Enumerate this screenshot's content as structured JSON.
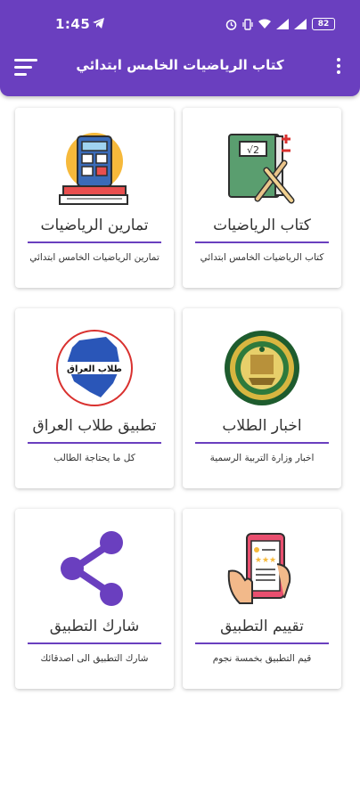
{
  "status_bar": {
    "time": "1:45",
    "battery": "82"
  },
  "app_bar": {
    "title": "كتاب الرياضيات الخامس ابتدائي"
  },
  "cards": [
    {
      "title": "كتاب الرياضيات",
      "description": "كتاب الرياضيات الخامس ابتدائي",
      "icon": "math-book-icon"
    },
    {
      "title": "تمارين الرياضيات",
      "description": "تمارين الرياضيات الخامس ابتدائي",
      "icon": "calculator-books-icon"
    },
    {
      "title": "اخبار الطلاب",
      "description": "اخبار وزارة التربية الرسمية",
      "icon": "ministry-seal-icon"
    },
    {
      "title": "تطبيق طلاب العراق",
      "description": "كل ما يحتاجة الطالب",
      "icon": "iraq-map-logo-icon",
      "logo_text": "طلاب العراق"
    },
    {
      "title": "تقييم التطبيق",
      "description": "قيم التطبيق بخمسة نجوم",
      "icon": "rate-phone-icon"
    },
    {
      "title": "شارك التطبيق",
      "description": "شارك التطبيق الى اصدقائك",
      "icon": "share-icon"
    }
  ],
  "colors": {
    "accent": "#6a3fbf",
    "background": "#ffffff"
  }
}
